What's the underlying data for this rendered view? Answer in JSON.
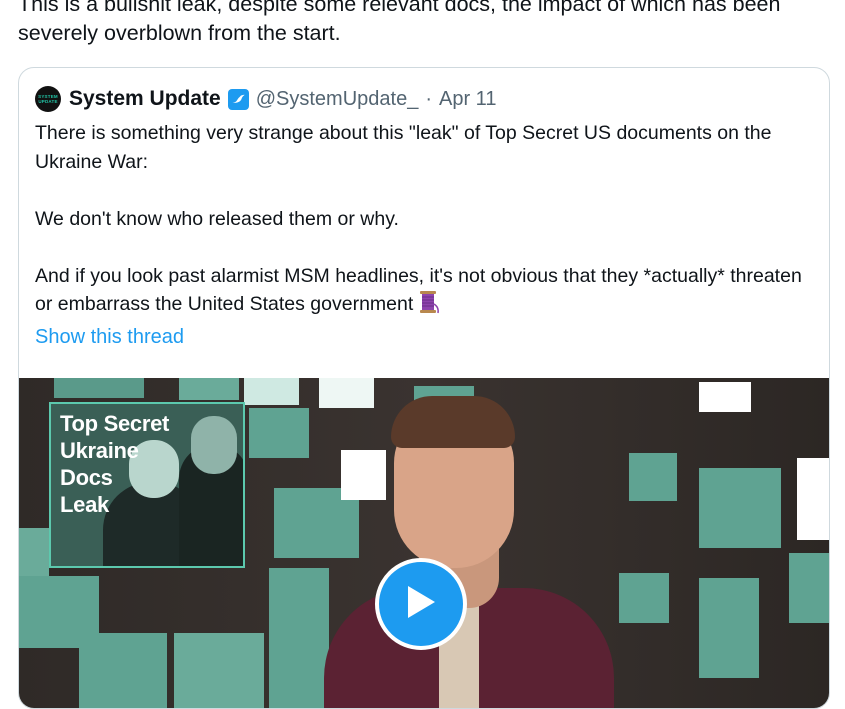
{
  "tweet": {
    "text": "This is a bullshit leak, despite some relevant docs, the impact of which has been severely overblown from the start."
  },
  "quoted_tweet": {
    "avatar_text": [
      "SYSTEM",
      "UPDATE"
    ],
    "author_name": "System Update",
    "handle": "@SystemUpdate_",
    "separator": "·",
    "date": "Apr 11",
    "paragraphs": [
      "There is something very strange about this \"leak\" of Top Secret US documents on the Ukraine War:",
      "We don't know who released them or why.",
      "And if you look past alarmist MSM headlines, it's not obvious that they *actually* threaten or embarrass the United States government"
    ],
    "show_thread_label": "Show this thread",
    "media": {
      "thumbnail_title": [
        "Top Secret",
        "Ukraine",
        "Docs",
        "Leak"
      ]
    }
  },
  "colors": {
    "accent": "#1d9bf0",
    "text": "#0f1419",
    "muted": "#536471",
    "border": "#cfd9de",
    "tile_teal": "#5fa392"
  },
  "icons": [
    "verified-badge-icon",
    "thread-spool-icon",
    "play-icon"
  ]
}
